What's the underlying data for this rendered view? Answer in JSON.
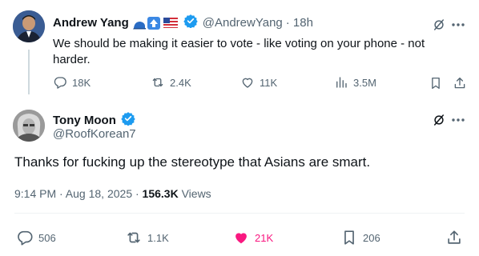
{
  "reply_parent": {
    "author_name": "Andrew Yang",
    "handle": "@AndrewYang",
    "time": "· 18h",
    "text": "We should be making it easier to vote - like voting on your phone - not harder.",
    "stats": {
      "replies": "18K",
      "reposts": "2.4K",
      "likes": "11K",
      "views": "3.5M"
    }
  },
  "main_tweet": {
    "author_name": "Tony Moon",
    "handle": "@RoofKorean7",
    "text": "Thanks for fucking up the stereotype that Asians are smart.",
    "timestamp": "9:14 PM · Aug 18, 2025 · ",
    "views_count": "156.3K",
    "views_label": " Views",
    "stats": {
      "replies": "506",
      "reposts": "1.1K",
      "likes": "21K",
      "bookmarks": "206"
    }
  },
  "colors": {
    "verified": "#1d9bf0",
    "like_active": "#f91880",
    "muted": "#536471"
  },
  "icons": [
    "grok-icon",
    "more-icon",
    "reply-icon",
    "repost-icon",
    "like-icon",
    "views-icon",
    "bookmark-icon",
    "share-icon"
  ]
}
